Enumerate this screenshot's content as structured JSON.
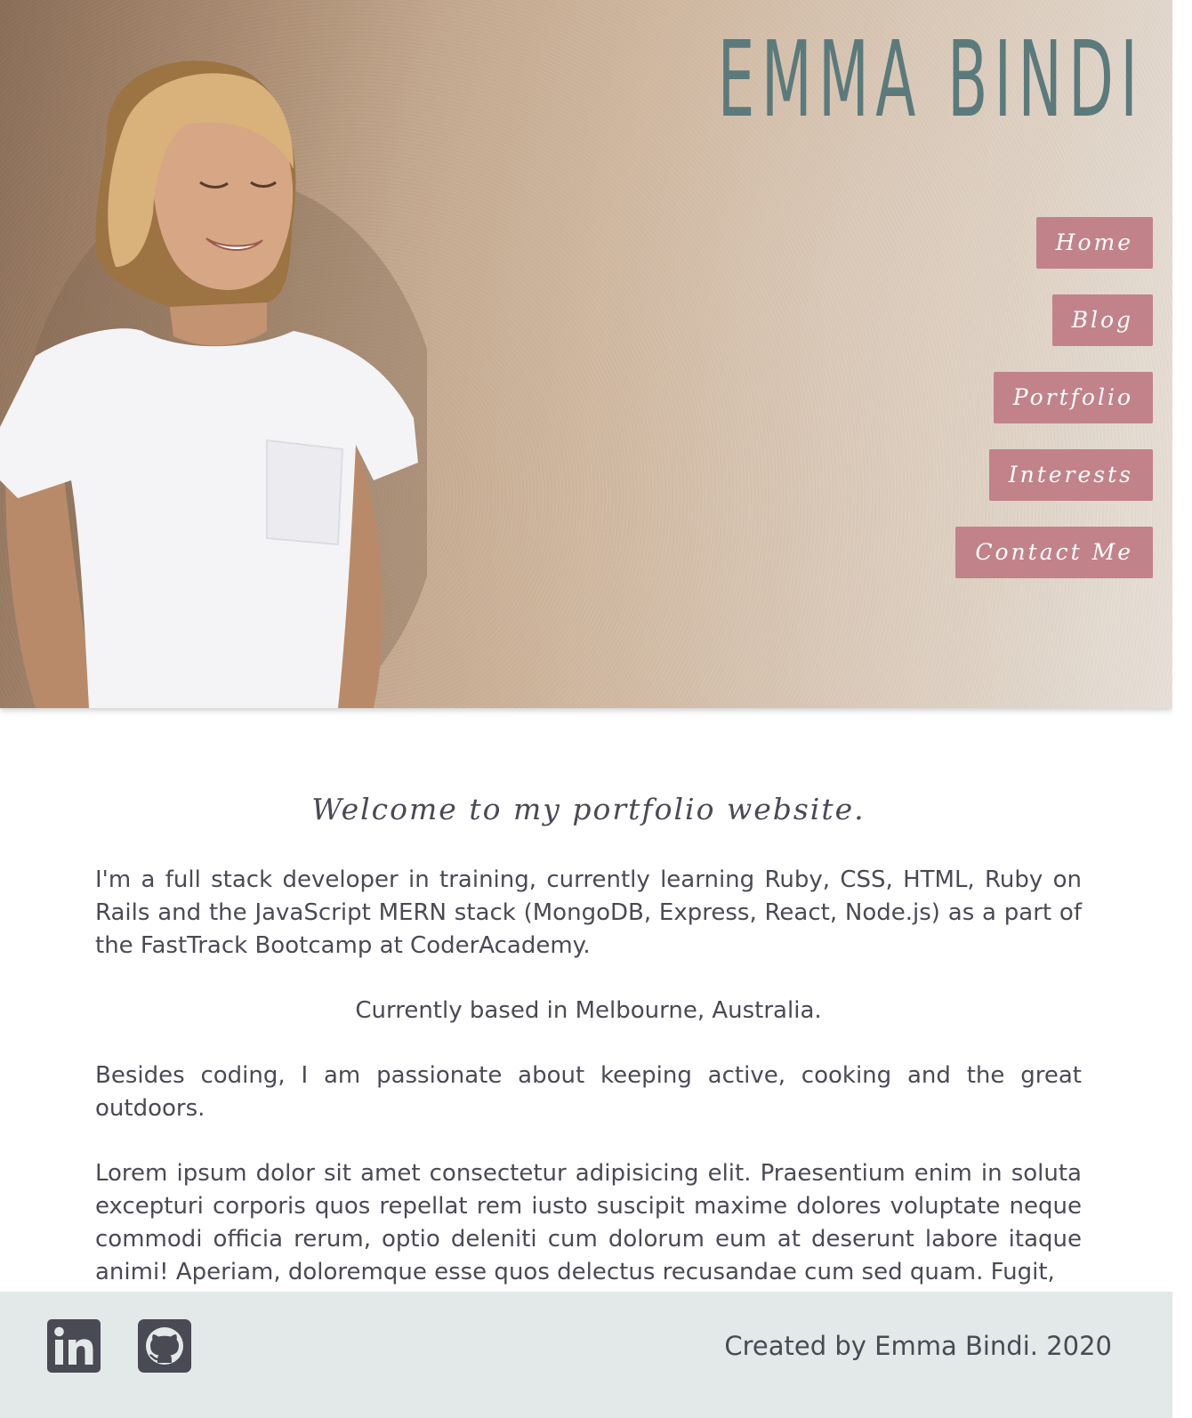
{
  "header": {
    "title": "EMMA BINDI"
  },
  "nav": {
    "items": [
      {
        "label": "Home"
      },
      {
        "label": "Blog"
      },
      {
        "label": "Portfolio"
      },
      {
        "label": "Interests"
      },
      {
        "label": "Contact Me"
      }
    ]
  },
  "main": {
    "welcome": "Welcome to my portfolio website.",
    "paragraphs": [
      "I'm a full stack developer in training, currently learning Ruby, CSS, HTML, Ruby on Rails and the JavaScript MERN stack (MongoDB, Express, React, Node.js) as a part of the FastTrack Bootcamp at CoderAcademy.",
      "Currently based in Melbourne, Australia.",
      "Besides coding, I am passionate about keeping active, cooking and the great outdoors.",
      "Lorem ipsum dolor sit amet consectetur adipisicing elit. Praesentium enim in soluta excepturi corporis quos repellat rem iusto suscipit maxime dolores voluptate neque commodi officia rerum, optio deleniti cum dolorum eum at deserunt labore itaque animi! Aperiam, doloremque esse quos delectus recusandae cum sed quam. Fugit,"
    ]
  },
  "footer": {
    "credit": "Created by Emma Bindi. 2020",
    "icons": [
      "linkedin-icon",
      "github-icon"
    ]
  },
  "colors": {
    "title": "#5b7a7c",
    "nav_button": "#c2828a",
    "text": "#4a4a55",
    "footer_bg": "#e3e8e8"
  }
}
